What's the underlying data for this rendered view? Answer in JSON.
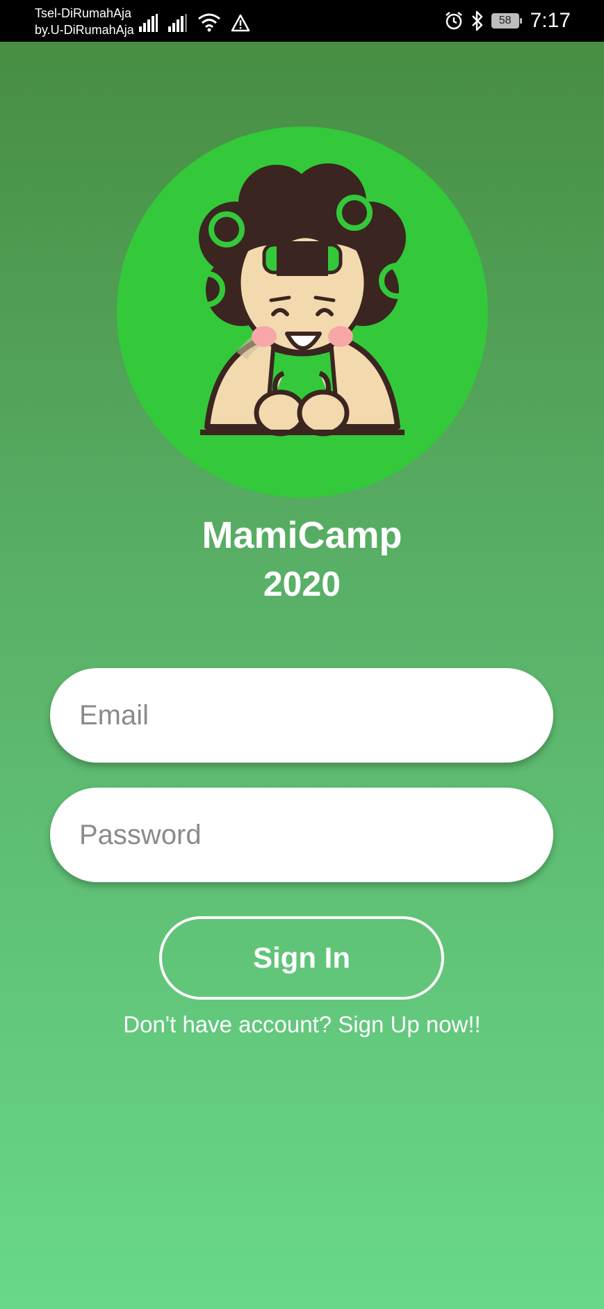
{
  "status_bar": {
    "carrier_line1": "Tsel-DiRumahAja",
    "carrier_line2": "by.U-DiRumahAja",
    "battery": "58",
    "time": "7:17"
  },
  "app": {
    "title": "MamiCamp",
    "year": "2020"
  },
  "form": {
    "email_placeholder": "Email",
    "email_value": "",
    "password_placeholder": "Password",
    "password_value": "",
    "sign_in_label": "Sign In",
    "signup_prompt": "Don't have account? Sign Up now!!"
  },
  "colors": {
    "background_top": "#468b40",
    "background_bottom": "#68d88a",
    "logo_circle": "#33c93a",
    "white": "#ffffff"
  },
  "icons": [
    "signal-icon",
    "wifi-icon",
    "warning-icon",
    "alarm-icon",
    "bluetooth-icon",
    "battery-icon"
  ]
}
